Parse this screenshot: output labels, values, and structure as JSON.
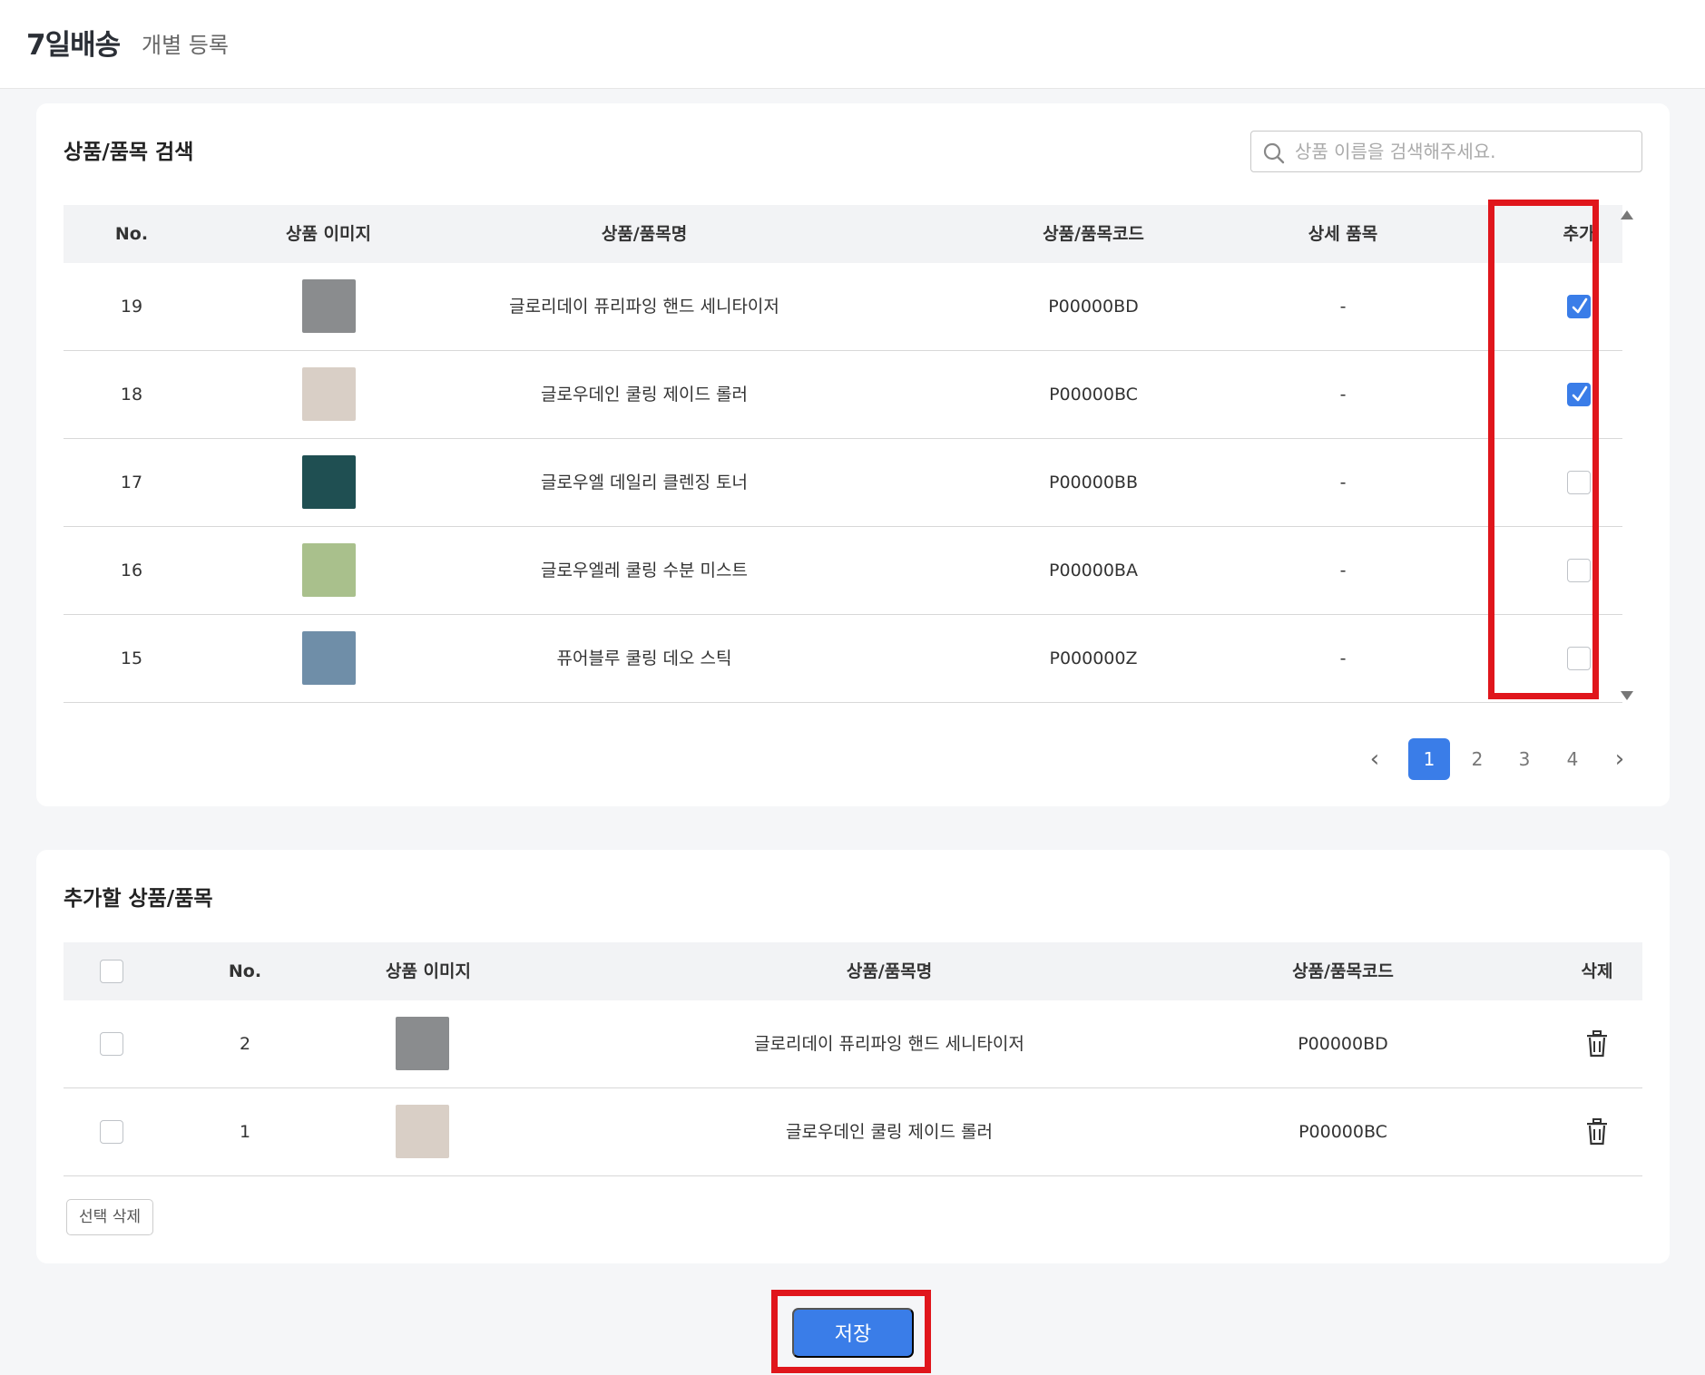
{
  "header": {
    "title": "7일배송",
    "subtitle": "개별 등록"
  },
  "search_section": {
    "title": "상품/품목 검색",
    "search_placeholder": "상품 이름을 검색해주세요.",
    "columns": [
      "No.",
      "상품 이미지",
      "상품/품목명",
      "상품/품목코드",
      "상세 품목",
      "추가"
    ],
    "rows": [
      {
        "no": "19",
        "name": "글로리데이 퓨리파잉 핸드 세니타이저",
        "code": "P00000BD",
        "detail": "-",
        "added": true,
        "thumb_color": "#8a8c8e"
      },
      {
        "no": "18",
        "name": "글로우데인 쿨링 제이드 롤러",
        "code": "P00000BC",
        "detail": "-",
        "added": true,
        "thumb_color": "#d9cfc6"
      },
      {
        "no": "17",
        "name": "글로우엘 데일리 클렌징 토너",
        "code": "P00000BB",
        "detail": "-",
        "added": false,
        "thumb_color": "#1f4f52"
      },
      {
        "no": "16",
        "name": "글로우엘레 쿨링 수분 미스트",
        "code": "P00000BA",
        "detail": "-",
        "added": false,
        "thumb_color": "#a9c08c"
      },
      {
        "no": "15",
        "name": "퓨어블루 쿨링 데오 스틱",
        "code": "P000000Z",
        "detail": "-",
        "added": false,
        "thumb_color": "#6f8ea8"
      }
    ],
    "pagination": {
      "prev": "‹",
      "next": "›",
      "pages": [
        "1",
        "2",
        "3",
        "4"
      ],
      "current": "1"
    }
  },
  "added_section": {
    "title": "추가할 상품/품목",
    "columns": [
      "No.",
      "상품 이미지",
      "상품/품목명",
      "상품/품목코드",
      "삭제"
    ],
    "rows": [
      {
        "no": "2",
        "name": "글로리데이 퓨리파잉 핸드 세니타이저",
        "code": "P00000BD",
        "thumb_color": "#8a8c8e"
      },
      {
        "no": "1",
        "name": "글로우데인 쿨링 제이드 롤러",
        "code": "P00000BC",
        "thumb_color": "#d9cfc6"
      }
    ],
    "delete_selected_label": "선택 삭제"
  },
  "save_label": "저장",
  "colors": {
    "accent": "#3a7de8",
    "highlight": "#e0161c"
  }
}
